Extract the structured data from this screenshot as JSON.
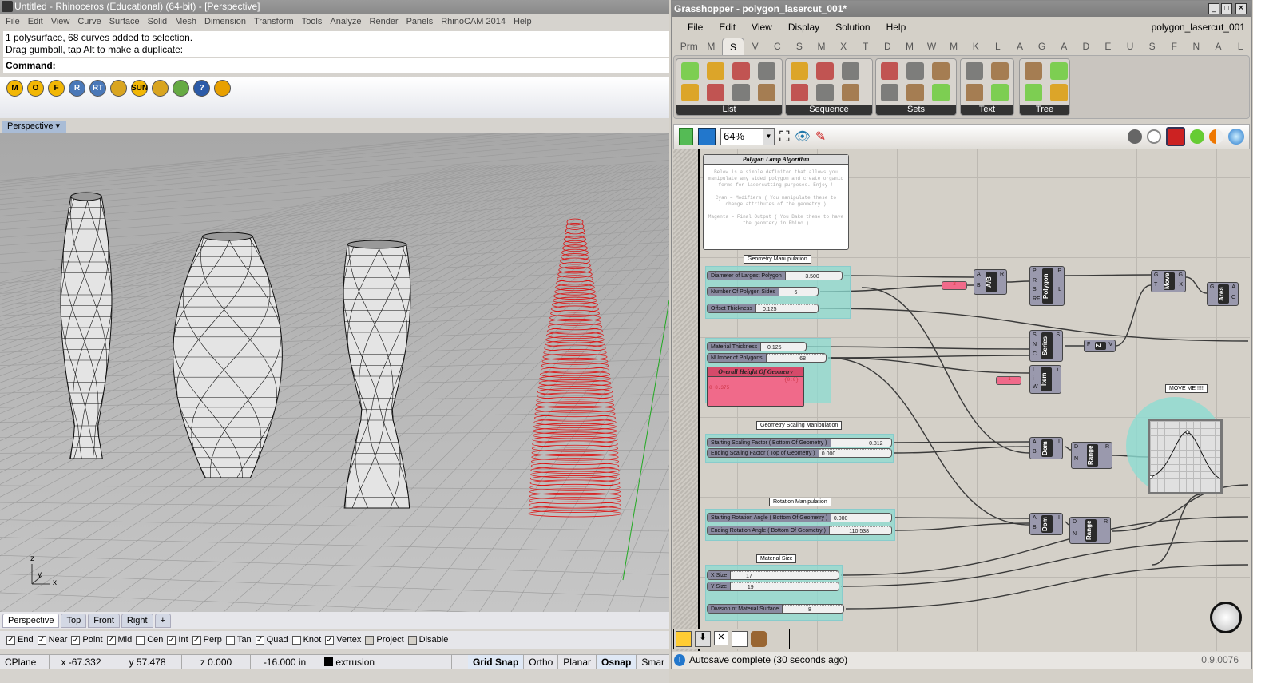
{
  "rhino": {
    "title": "Untitled - Rhinoceros (Educational) (64-bit) - [Perspective]",
    "menu": [
      "File",
      "Edit",
      "View",
      "Curve",
      "Surface",
      "Solid",
      "Mesh",
      "Dimension",
      "Transform",
      "Tools",
      "Analyze",
      "Render",
      "Panels",
      "RhinoCAM 2014",
      "Help"
    ],
    "history": [
      "1 polysurface, 68 curves added to selection.",
      "Drag gumball, tap Alt to make a duplicate:"
    ],
    "command_label": "Command:",
    "toolbar": [
      {
        "icon": "m-icon",
        "t": "M"
      },
      {
        "icon": "tag-o-icon",
        "t": "O"
      },
      {
        "icon": "tag-f-icon",
        "t": "F"
      },
      {
        "icon": "render-icon",
        "t": "R"
      },
      {
        "icon": "rt-icon",
        "t": "RT"
      },
      {
        "icon": "plane-icon",
        "t": ""
      },
      {
        "icon": "sun-icon",
        "t": "SUN"
      },
      {
        "icon": "light-icon",
        "t": ""
      },
      {
        "icon": "tree-icon",
        "t": ""
      },
      {
        "icon": "help-icon",
        "t": "?"
      },
      {
        "icon": "target-icon",
        "t": ""
      }
    ],
    "viewport_label": "Perspective",
    "axes": {
      "z": "z",
      "y": "y",
      "x": "x"
    },
    "view_tabs": [
      "Perspective",
      "Top",
      "Front",
      "Right",
      "+"
    ],
    "osnaps": [
      {
        "l": "End",
        "c": true
      },
      {
        "l": "Near",
        "c": true
      },
      {
        "l": "Point",
        "c": true
      },
      {
        "l": "Mid",
        "c": true
      },
      {
        "l": "Cen",
        "c": false
      },
      {
        "l": "Int",
        "c": true
      },
      {
        "l": "Perp",
        "c": true
      },
      {
        "l": "Tan",
        "c": false
      },
      {
        "l": "Quad",
        "c": true
      },
      {
        "l": "Knot",
        "c": false
      },
      {
        "l": "Vertex",
        "c": true
      },
      {
        "l": "Project",
        "c": false,
        "btn": true
      },
      {
        "l": "Disable",
        "c": false,
        "btn": true
      }
    ],
    "status": {
      "cplane": "CPlane",
      "x": "x -67.332",
      "y": "y 57.478",
      "z": "z 0.000",
      "dist": "-16.000 in",
      "layer": "extrusion",
      "grid_snap": "Grid Snap",
      "ortho": "Ortho",
      "planar": "Planar",
      "osnap": "Osnap",
      "smart": "Smar"
    }
  },
  "gh": {
    "title": "Grasshopper - polygon_lasercut_001*",
    "menu": [
      "File",
      "Edit",
      "View",
      "Display",
      "Solution",
      "Help"
    ],
    "doc_name": "polygon_lasercut_001",
    "categories": [
      "Prm",
      "M",
      "S",
      "V",
      "C",
      "S",
      "M",
      "X",
      "T",
      "D",
      "M",
      "W",
      "M",
      "K",
      "L",
      "A",
      "G",
      "A",
      "D",
      "E",
      "U",
      "S",
      "F",
      "N",
      "A",
      "L"
    ],
    "active_category": 2,
    "ribbon_groups": [
      "List",
      "Sequence",
      "Sets",
      "Text",
      "Tree"
    ],
    "zoom": "64%",
    "status": "Autosave complete (30 seconds ago)",
    "version": "0.9.0076",
    "canvas": {
      "panel_title": "Polygon Lamp Algorithm",
      "panel_text": [
        "Below is a simple definiton that allows you manipulate any sided polygon and create organic forms for lasercutting purposes. Enjoy !",
        "Cyan = Modifiers ( You manipulate these to change attributes of the geometry )",
        "Magenta = Final Output ( You Bake these to have the geomtery in Rhino )"
      ],
      "groups": [
        "Geometry Manupulation",
        "Geometry Scaling Manipulation",
        "Rotation Manipulation",
        "Material Size",
        "MOVE ME !!!!"
      ],
      "sliders": [
        {
          "name": "Diameter of Largest Polygon",
          "value": "3.500"
        },
        {
          "name": "Number Of Polygon Sides",
          "value": "6"
        },
        {
          "name": "Offset Thickness",
          "value": "0.125"
        },
        {
          "name": "Material Thickness",
          "value": "0.125"
        },
        {
          "name": "NUmber of Polygons",
          "value": "68"
        },
        {
          "name": "Starting Scaling Factor ( Bottom Of Geometry )",
          "value": "0.812"
        },
        {
          "name": "Ending Scaling Factor ( Top of Geometry )",
          "value": "0.000"
        },
        {
          "name": "Starting Rotation Angle ( Bottom Of Geometry )",
          "value": "0.000"
        },
        {
          "name": "Ending Rotation Angle ( Bottom Of Geometry )",
          "value": "110.538"
        },
        {
          "name": "X Size",
          "value": "17"
        },
        {
          "name": "Y Size",
          "value": "19"
        },
        {
          "name": "Division of Material Surface",
          "value": "8"
        }
      ],
      "output_panel": {
        "title": "Overall Height Of Geometry",
        "path": "{0;0}",
        "row": "0  8.375"
      },
      "pink_values": [
        "2",
        "-1"
      ],
      "components": [
        "A/B",
        "Polygon",
        "Move",
        "Area",
        "Series",
        "Z",
        "Item",
        "Dom",
        "Range",
        "Dom",
        "Range"
      ]
    }
  }
}
